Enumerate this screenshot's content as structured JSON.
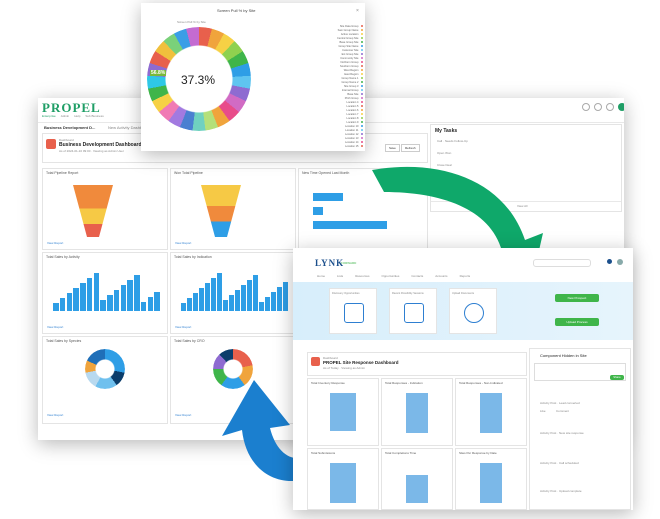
{
  "popup": {
    "title": "Screen Pull % by Site",
    "subtitle": "Screen Pull % by Site",
    "center_value": "37.3%",
    "slice_label": "56.8%",
    "legend": [
      "Site Data Group",
      "Sam Group Name",
      "Active Location",
      "Central Group Site",
      "Base Group Site",
      "Group Site Name",
      "Customer Site",
      "Ext Group Site",
      "Community Site",
      "Northern Group",
      "Southern Group",
      "West Region",
      "East Region",
      "Group Name 1",
      "Group Name 2",
      "Site Group 3",
      "Internal Group",
      "Base Site",
      "Pitch Group",
      "Location 4",
      "Location 5",
      "Location 6",
      "Location 7",
      "Location 8",
      "Location 9",
      "Location 10",
      "Location 11",
      "Location 12",
      "Location 13",
      "Location 14",
      "Location 15"
    ]
  },
  "propel": {
    "logo": "PROPEL",
    "nav": [
      "Enterprise",
      "Admin",
      "Help",
      "Sub Business"
    ],
    "tab_active": "Business Development D...",
    "tab_other": "New Activity Dashboard",
    "header_tag": "Dashboard",
    "header_title": "Business Development Dashboard",
    "header_sub": "As of 2024-01-10 09:00 · Viewing as Admin User",
    "btn_save": "Save",
    "btn_refresh": "Refresh",
    "my_tasks": "My Tasks",
    "view_all": "View All",
    "cards": [
      "Total Pipeline Report",
      "Won Total Pipeline",
      "New Time Opened Last Month",
      "Total Sales by Activity",
      "Total Sales by Indication",
      "Total Sales by Species",
      "Total Sales by CRO"
    ],
    "card_link": "View Report",
    "task_rows": [
      "Call · Needs Follow-Up",
      "Open Won",
      "Close Deal",
      "Review Lead"
    ]
  },
  "lynk": {
    "logo": "LYNK",
    "logo_sub": "FORWARD",
    "nav": [
      "Home",
      "Lists",
      "Resources",
      "Opportunities",
      "Contacts",
      "Accounts",
      "Reports"
    ],
    "tiles": [
      "Discovery Opportunities",
      "Recent Possibility Sessions",
      "Upload Documents"
    ],
    "green_btn_1": "New Prospect",
    "green_btn_2": "Upload Process",
    "header_tag": "Dashboard",
    "header_title": "PROPEL Site Response Dashboard",
    "header_sub": "As of Today · Viewing as Admin",
    "cards": [
      "Total Inventory Response",
      "Total Responses - Indication",
      "Total Responses - Non-Indicated",
      "Total Submissions",
      "Total Completions Time",
      "Sites Per Response by Date",
      "Site Response Time - Month"
    ],
    "right_title": "Component Hidden in Site",
    "right_btn": "Share",
    "feed": [
      "Activity Post · Lead converted",
      "Activity Post · New site response",
      "Activity Post · Call scheduled",
      "Activity Post · Upload complete"
    ],
    "like": "Like",
    "comment": "Comment"
  },
  "colors": {
    "propel_green": "#1f9e66",
    "chart_blue": "#2e9ee6",
    "funnel_orange": "#f08a3c",
    "funnel_yellow": "#f6c945",
    "arrow_green": "#0fa86a",
    "arrow_blue": "#1b7fcf",
    "lynk_green": "#3fb54a"
  }
}
